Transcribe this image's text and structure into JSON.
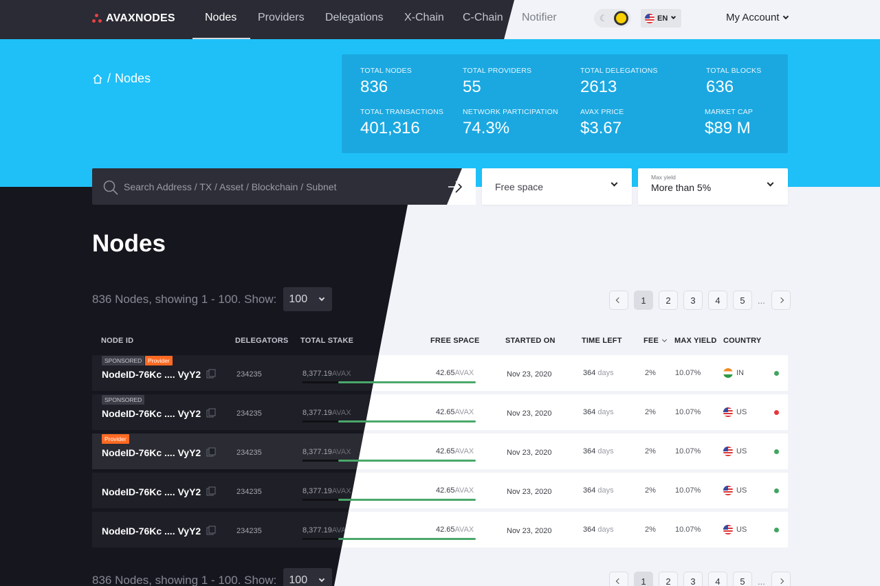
{
  "brand": "AVAXNODES",
  "nav": {
    "items": [
      "Nodes",
      "Providers",
      "Delegations",
      "X-Chain",
      "C-Chain"
    ],
    "notifier": "Notifier",
    "language": "EN",
    "account": "My Account"
  },
  "breadcrumb": {
    "separator": "/",
    "current": "Nodes"
  },
  "stats": [
    {
      "label": "TOTAL NODES",
      "value": "836"
    },
    {
      "label": "TOTAL PROVIDERS",
      "value": "55"
    },
    {
      "label": "TOTAL DELEGATIONS",
      "value": "2613"
    },
    {
      "label": "TOTAL BLOCKS",
      "value": "636"
    },
    {
      "label": "TOTAL TRANSACTIONS",
      "value": "401,316"
    },
    {
      "label": "NETWORK PARTICIPATION",
      "value": "74.3%"
    },
    {
      "label": "AVAX PRICE",
      "value": "$3.67"
    },
    {
      "label": "MARKET CAP",
      "value": "$89 M"
    }
  ],
  "search": {
    "placeholder": "Search Address / TX / Asset / Blockchain / Subnet"
  },
  "filters": {
    "free_space": "Free space",
    "max_yield_caption": "Max yield",
    "max_yield_value": "More than 5%"
  },
  "page_title": "Nodes",
  "listing": {
    "summary": "836 Nodes, showing 1 - 100. Show:",
    "page_size": "100"
  },
  "pagination": {
    "pages": [
      "1",
      "2",
      "3",
      "4",
      "5"
    ],
    "ellipsis": "...",
    "current": "1"
  },
  "table": {
    "headers": [
      "NODE ID",
      "DELEGATORS",
      "TOTAL STAKE",
      "FREE SPACE",
      "STARTED ON",
      "TIME LEFT",
      "FEE",
      "MAX YIELD",
      "COUNTRY"
    ],
    "rows": [
      {
        "tags": [
          "SPONSORED",
          "Provider"
        ],
        "node_id": "NodeID-76Kc .... VyY2",
        "delegators": "234235",
        "stake": "8,377.19",
        "stake_unit": "AVAX",
        "free": "42.65",
        "free_unit": "AVAX",
        "free_fraction": 0.95,
        "started": "Nov 23, 2020",
        "days": "364",
        "days_unit": "days",
        "fee": "2%",
        "yield": "10.07%",
        "country": "IN",
        "status_color": "#3fa55f"
      },
      {
        "tags": [
          "SPONSORED"
        ],
        "node_id": "NodeID-76Kc .... VyY2",
        "delegators": "234235",
        "stake": "8,377.19",
        "stake_unit": "AVAX",
        "free": "42.65",
        "free_unit": "AVAX",
        "free_fraction": 0.95,
        "started": "Nov 23, 2020",
        "days": "364",
        "days_unit": "days",
        "fee": "2%",
        "yield": "10.07%",
        "country": "US",
        "status_color": "#e8373a"
      },
      {
        "tags": [
          "Provider"
        ],
        "node_id": "NodeID-76Kc .... VyY2",
        "delegators": "234235",
        "stake": "8,377.19",
        "stake_unit": "AVAX",
        "free": "42.65",
        "free_unit": "AVAX",
        "free_fraction": 0.95,
        "started": "Nov 23, 2020",
        "days": "364",
        "days_unit": "days",
        "fee": "2%",
        "yield": "10.07%",
        "country": "US",
        "status_color": "#3fa55f"
      },
      {
        "tags": [],
        "node_id": "NodeID-76Kc .... VyY2",
        "delegators": "234235",
        "stake": "8,377.19",
        "stake_unit": "AVAX",
        "free": "42.65",
        "free_unit": "AVAX",
        "free_fraction": 0.95,
        "started": "Nov 23, 2020",
        "days": "364",
        "days_unit": "days",
        "fee": "2%",
        "yield": "10.07%",
        "country": "US",
        "status_color": "#3fa55f"
      },
      {
        "tags": [],
        "node_id": "NodeID-76Kc .... VyY2",
        "delegators": "234235",
        "stake": "8,377.19",
        "stake_unit": "AVAX",
        "free": "42.65",
        "free_unit": "AVAX",
        "free_fraction": 0.95,
        "started": "Nov 23, 2020",
        "days": "364",
        "days_unit": "days",
        "fee": "2%",
        "yield": "10.07%",
        "country": "US",
        "status_color": "#3fa55f"
      }
    ]
  },
  "colors": {
    "accent_blue": "#1fc0f8",
    "dark_bg": "#16161e",
    "provider_orange": "#ff6a22",
    "bar_green": "#4aa86a",
    "status_green": "#3fa55f",
    "status_red": "#e8373a"
  }
}
